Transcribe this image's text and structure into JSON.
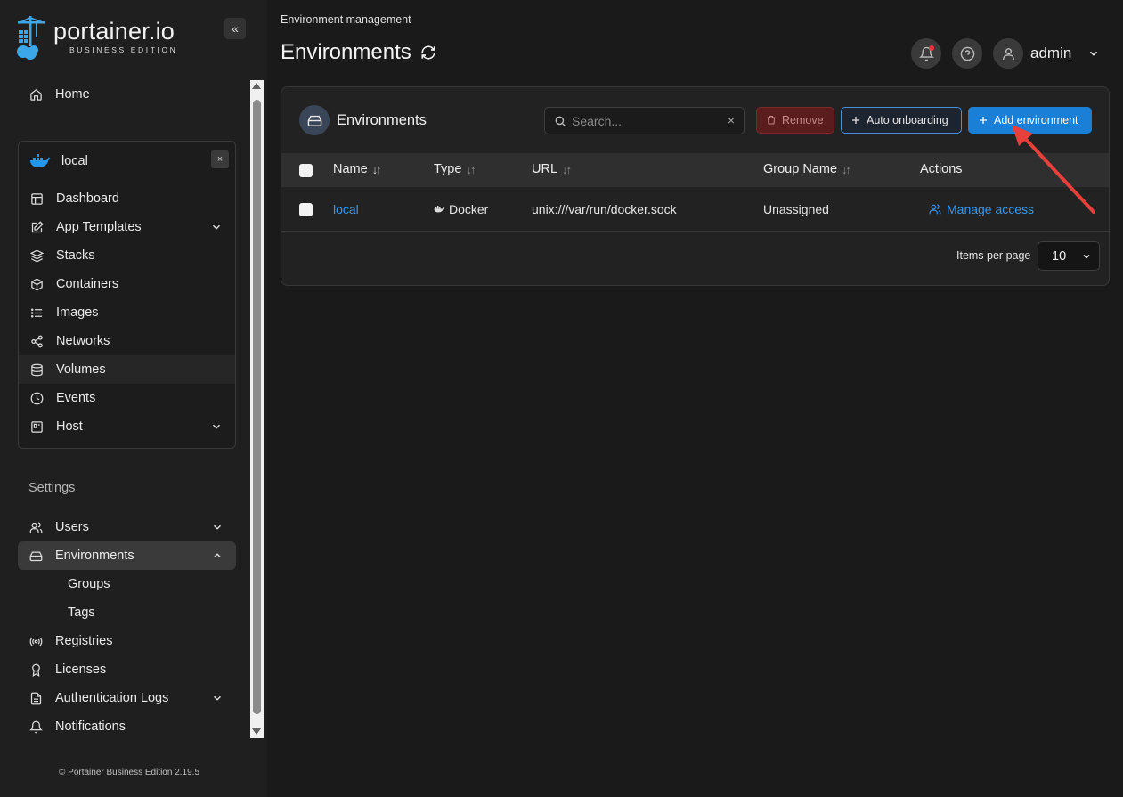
{
  "brand": {
    "name": "portainer.io",
    "edition": "BUSINESS EDITION",
    "collapse_label": "«"
  },
  "sidebar": {
    "home": "Home",
    "environment": {
      "name": "local",
      "close_label": "×"
    },
    "env_items": [
      {
        "label": "Dashboard"
      },
      {
        "label": "App Templates"
      },
      {
        "label": "Stacks"
      },
      {
        "label": "Containers"
      },
      {
        "label": "Images"
      },
      {
        "label": "Networks"
      },
      {
        "label": "Volumes"
      },
      {
        "label": "Events"
      },
      {
        "label": "Host"
      }
    ],
    "settings_label": "Settings",
    "settings_items": [
      {
        "label": "Users"
      },
      {
        "label": "Environments"
      },
      {
        "label": "Groups"
      },
      {
        "label": "Tags"
      },
      {
        "label": "Registries"
      },
      {
        "label": "Licenses"
      },
      {
        "label": "Authentication Logs"
      },
      {
        "label": "Notifications"
      }
    ],
    "footer": "© Portainer Business Edition 2.19.5"
  },
  "header": {
    "breadcrumb": "Environment management",
    "title": "Environments",
    "user": "admin"
  },
  "card": {
    "title": "Environments",
    "search_placeholder": "Search...",
    "clear_label": "×",
    "remove_label": "Remove",
    "auto_onboarding_label": "Auto onboarding",
    "add_environment_label": "Add environment",
    "columns": [
      "Name",
      "Type",
      "URL",
      "Group Name",
      "Actions"
    ],
    "sort_glyph_down": "↓",
    "sort_glyph_up": "↑",
    "rows": [
      {
        "name": "local",
        "type": "Docker",
        "url": "unix:///var/run/docker.sock",
        "group": "Unassigned",
        "action": "Manage access"
      }
    ],
    "items_per_page_label": "Items per page",
    "items_per_page_value": "10"
  },
  "colors": {
    "accent": "#1a7fd6",
    "link": "#3b96e6",
    "danger": "#5a1c1c",
    "annotation_arrow": "#e8403a"
  }
}
